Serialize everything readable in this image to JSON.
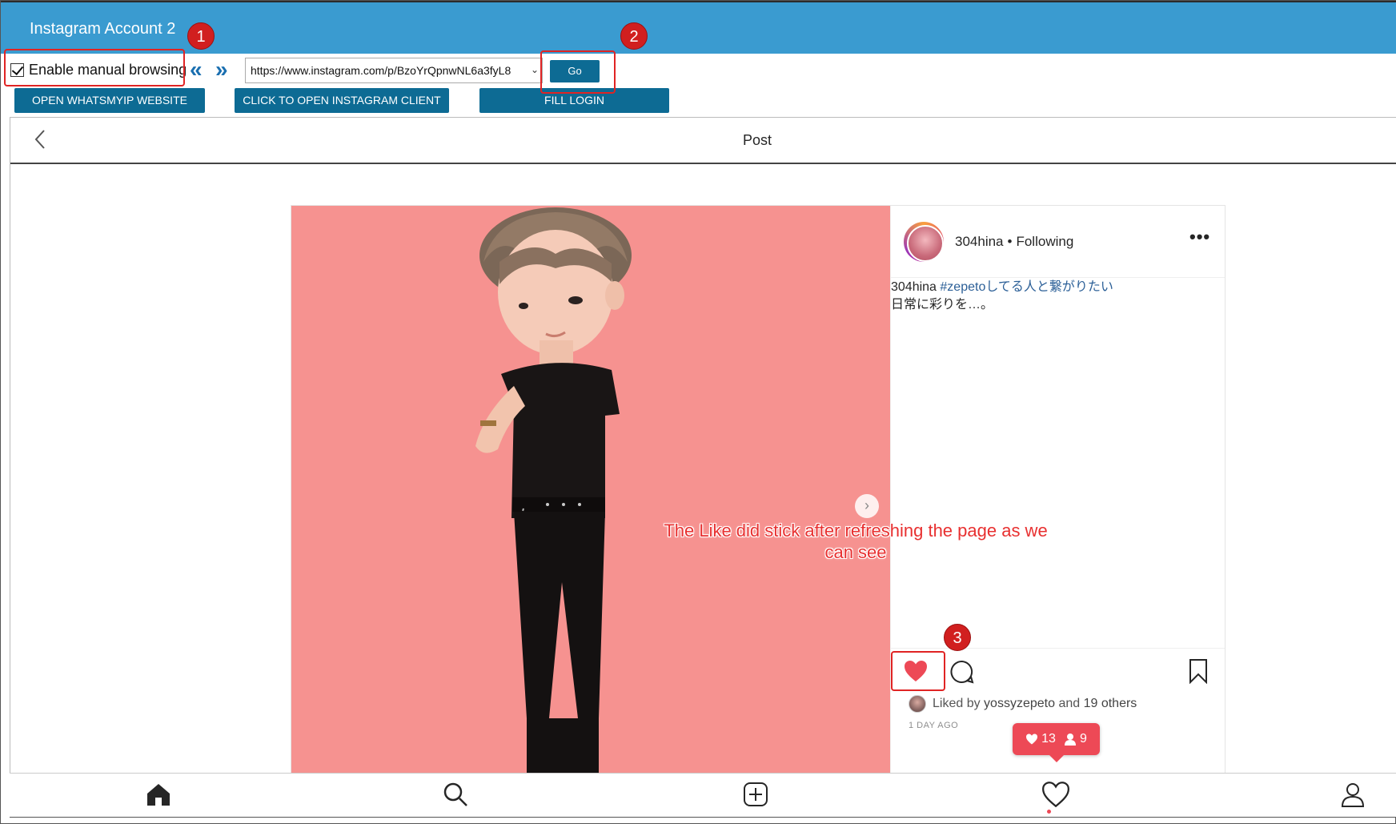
{
  "window": {
    "title": "Instagram Account 2"
  },
  "toolbar": {
    "manual_browsing_label": "Enable manual browsing",
    "manual_browsing_checked": true,
    "back_glyph": "«",
    "forward_glyph": "»",
    "url": "https://www.instagram.com/p/BzoYrQpnwNL6a3fyL8",
    "go_label": "Go",
    "buttons": {
      "whatsmyip": "OPEN WHATSMYIP WEBSITE",
      "instagram_client": "CLICK TO OPEN INSTAGRAM CLIENT",
      "fill_login": "FILL LOGIN"
    }
  },
  "annotations": {
    "badge1": "1",
    "badge2": "2",
    "badge3": "3",
    "note": "The Like did stick after refreshing the page as we can see"
  },
  "page": {
    "header_title": "Post",
    "back_icon": "chevron-left-icon"
  },
  "post": {
    "username": "304hina",
    "follow_status": "Following",
    "separator": "•",
    "more_glyph": "•••",
    "caption_user": "304hina",
    "caption_hashtag": "#zepeto",
    "caption_line1_rest": "してる人と繋がりたい",
    "caption_line2": "日常に彩りを…。",
    "liked": true,
    "liked_by_prefix": "Liked by",
    "liked_by_user": "yossyzepeto",
    "liked_by_and": "and",
    "liked_by_others": "19 others",
    "time_ago": "1 DAY AGO",
    "image_bg": "#f69290"
  },
  "notification": {
    "likes_count": "13",
    "followers_count": "9",
    "color": "#ed4956"
  },
  "bottom_nav": [
    "home-icon",
    "search-icon",
    "new-post-icon",
    "activity-heart-icon",
    "profile-icon"
  ],
  "colors": {
    "titlebar": "#3a9bd0",
    "button": "#0d6b94",
    "annotation_red": "#e02424",
    "hashtag": "#2b5f97"
  }
}
